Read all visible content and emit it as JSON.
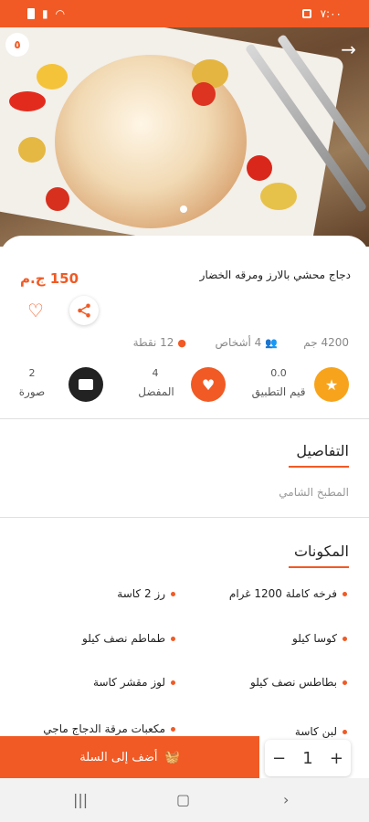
{
  "status_bar": {
    "time": "٧:٠٠"
  },
  "hero": {
    "badge": "٥",
    "dots": 1
  },
  "dish": {
    "title": "دجاج محشي بالارز ومرقه الخضار",
    "price": "150 ج.م"
  },
  "meta": {
    "weight": "4200 جم",
    "persons": "4 أشخاص",
    "points": "12 نقطة"
  },
  "stats": {
    "rating_value": "0.0",
    "rating_label": "قيم التطبيق",
    "favorite_value": "4",
    "favorite_label": "المفضل",
    "images_value": "2",
    "images_label": "صورة"
  },
  "details": {
    "title": "التفاصيل",
    "text": "المطبخ الشامي"
  },
  "ingredients": {
    "title": "المكونات",
    "items": [
      "فرخه كاملة 1200 غرام",
      "رز 2 كاسة",
      "كوسا كيلو",
      "طماطم نصف كيلو",
      "بطاطس نصف كيلو",
      "لوز مقشر كاسة",
      "لبن كاسة",
      "مكعبات مرقة الدجاج ماجي"
    ]
  },
  "cart": {
    "add_label": "أضف إلى السلة",
    "quantity": "1",
    "minus": "−",
    "plus": "+"
  },
  "colors": {
    "accent": "#f15a24",
    "dark": "#222222"
  },
  "icons": [
    "share-icon",
    "heart-icon",
    "star-icon",
    "image-icon",
    "group-icon",
    "coins-icon",
    "basket-icon",
    "arrow-right-icon"
  ]
}
